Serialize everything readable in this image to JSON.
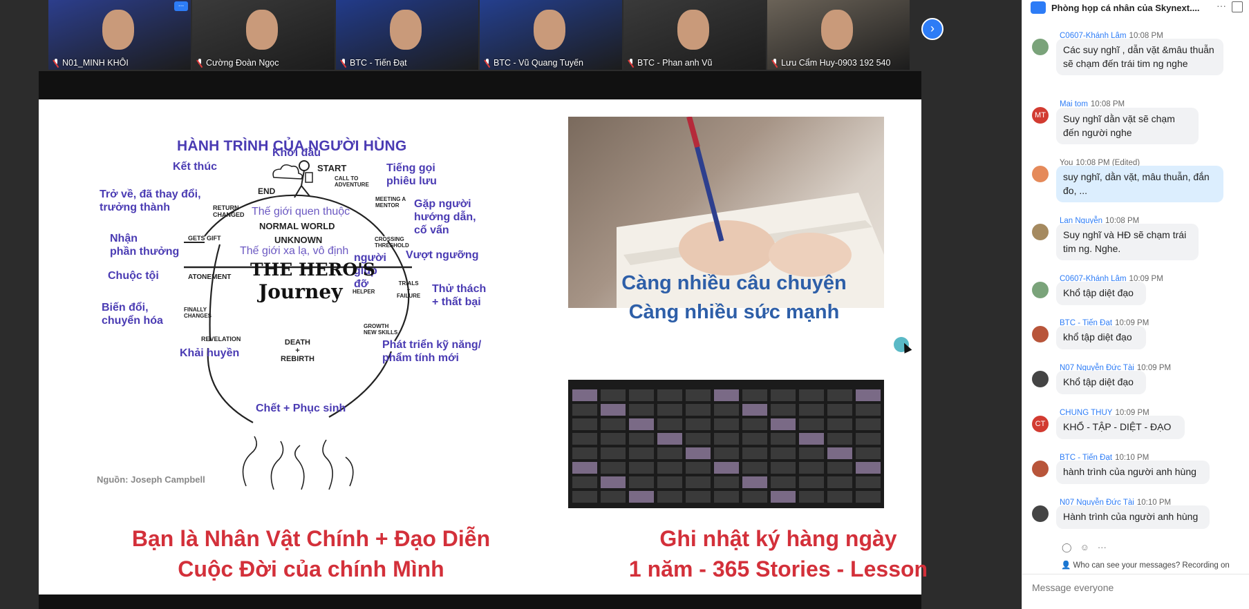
{
  "participants": [
    {
      "name": "N01_MINH KHÔI",
      "active": true,
      "bg": "#2c3e8c"
    },
    {
      "name": "Cường Đoàn Ngọc",
      "active": false,
      "bg": "#3a3a3a"
    },
    {
      "name": "BTC - Tiến Đạt",
      "active": false,
      "bg": "#223b8a"
    },
    {
      "name": "BTC - Vũ Quang Tuyến",
      "active": false,
      "bg": "#243f8e"
    },
    {
      "name": "BTC - Phan anh Vũ",
      "active": false,
      "bg": "#3a3a3a"
    },
    {
      "name": "Lưu Cẩm Huy-0903 192 540",
      "active": false,
      "bg": "#6b6358"
    }
  ],
  "strip_more": "...",
  "next_icon": "›",
  "slide": {
    "title": "HÀNH TRÌNH CỦA NGƯỜI HÙNG",
    "labels": {
      "ket_thuc": "Kết thúc",
      "khoi_dau": "Khởi đầu",
      "tieng_goi": "Tiếng gọi\nphiêu lưu",
      "tro_ve": "Trở về, đã thay đổi,\ntrưởng thành",
      "gap_nguoi": "Gặp người\nhướng dẫn,\ncố vấn",
      "nhan_phan_thuong": "Nhận\nphần thưởng",
      "vuot_nguong": "Vượt ngưỡng",
      "chuoc_toi": "Chuộc tội",
      "nguoi_giup_do": "người\ngiúp\nđỡ",
      "thu_thach": "Thử thách\n+ thất bại",
      "bien_doi": "Biến đổi,\nchuyển hóa",
      "phat_trien": "Phát triển kỹ năng/\nphẩm tính mới",
      "khai_huyen": "Khải huyền",
      "chet_phuc_sinh": "Chết + Phục sinh",
      "the_gioi_quen": "Thế giới quen thuộc",
      "the_gioi_xa_la": "Thế giới xa lạ, vô định"
    },
    "diagram_text": {
      "end": "END",
      "start": "START",
      "call": "CALL TO\nADVENTURE",
      "meeting": "MEETING A\nMENTOR",
      "return": "RETURN\nCHANGED",
      "normal": "NORMAL WORLD",
      "unknown": "UNKNOWN",
      "gets_gift": "GETS GIFT",
      "crossing": "CROSSING\nTHRESHOLD",
      "hero": "THE HERO'S",
      "journey": "Journey",
      "helper": "HELPER",
      "atonement": "ATONEMENT",
      "trials": "TRIALS\n+\nFAILURE",
      "finally": "FINALLY\nCHANGES",
      "growth": "GROWTH\nNEW SKILLS",
      "revelation": "REVELATION",
      "death": "DEATH\n+\nREBIRTH"
    },
    "source": "Nguồn: Joseph Campbell",
    "headline_1": "Càng nhiều câu chuyện",
    "headline_2": "Càng nhiều sức mạnh",
    "bottom_left_1": "Bạn là Nhân Vật Chính + Đạo Diễn",
    "bottom_left_2": "Cuộc Đời của chính Mình",
    "bottom_right_1": "Ghi nhật ký hàng ngày",
    "bottom_right_2": "1 năm - 365 Stories - Lesson"
  },
  "chat": {
    "title": "Phòng họp cá nhân của Skynext....",
    "dots": "···",
    "messages": [
      {
        "author": "C0607-Khánh Lâm",
        "time": "10:08 PM",
        "text": "Các suy nghĩ , dẫn vặt &mâu thuẫn sẽ chạm đến trái tim ng nghe",
        "avatar": "",
        "avatar_color": "#7aa37a",
        "mine": false
      },
      {
        "author": "Mai tom",
        "time": "10:08 PM",
        "text": "Suy nghĩ dằn vặt sẽ chạm đến người nghe",
        "avatar": "MT",
        "avatar_color": "#d23b31",
        "mine": false
      },
      {
        "author": "You",
        "time": "10:08 PM (Edited)",
        "text": "suy nghĩ, dằn vặt, mâu thuẫn, đắn đo, ...",
        "avatar": "",
        "avatar_color": "#e58a5a",
        "mine": true
      },
      {
        "author": "Lan Nguyễn",
        "time": "10:08 PM",
        "text": "Suy nghĩ và HĐ sẽ chạm trái tim ng. Nghe.",
        "avatar": "",
        "avatar_color": "#a58a60",
        "mine": false
      },
      {
        "author": "C0607-Khánh Lâm",
        "time": "10:09 PM",
        "text": "Khổ tập diệt đạo",
        "avatar": "",
        "avatar_color": "#7aa37a",
        "mine": false
      },
      {
        "author": "BTC - Tiến Đạt",
        "time": "10:09 PM",
        "text": "khổ tập diệt đạo",
        "avatar": "",
        "avatar_color": "#b8553a",
        "mine": false
      },
      {
        "author": "N07 Nguyễn Đức Tài",
        "time": "10:09 PM",
        "text": "Khổ tập diệt đạo",
        "avatar": "",
        "avatar_color": "#444",
        "mine": false
      },
      {
        "author": "CHUNG THUY",
        "time": "10:09 PM",
        "text": "KHỔ - TẬP - DIỆT - ĐẠO",
        "avatar": "CT",
        "avatar_color": "#d23b31",
        "mine": false
      },
      {
        "author": "BTC - Tiến Đạt",
        "time": "10:10 PM",
        "text": "hành trình của người anh hùng",
        "avatar": "",
        "avatar_color": "#b8553a",
        "mine": false
      },
      {
        "author": "N07 Nguyễn Đức Tài",
        "time": "10:10 PM",
        "text": "Hành trình của người anh hùng",
        "avatar": "",
        "avatar_color": "#444",
        "mine": false
      }
    ],
    "privacy_note": "Who can see your messages? Recording on",
    "input_placeholder": "Message everyone"
  }
}
